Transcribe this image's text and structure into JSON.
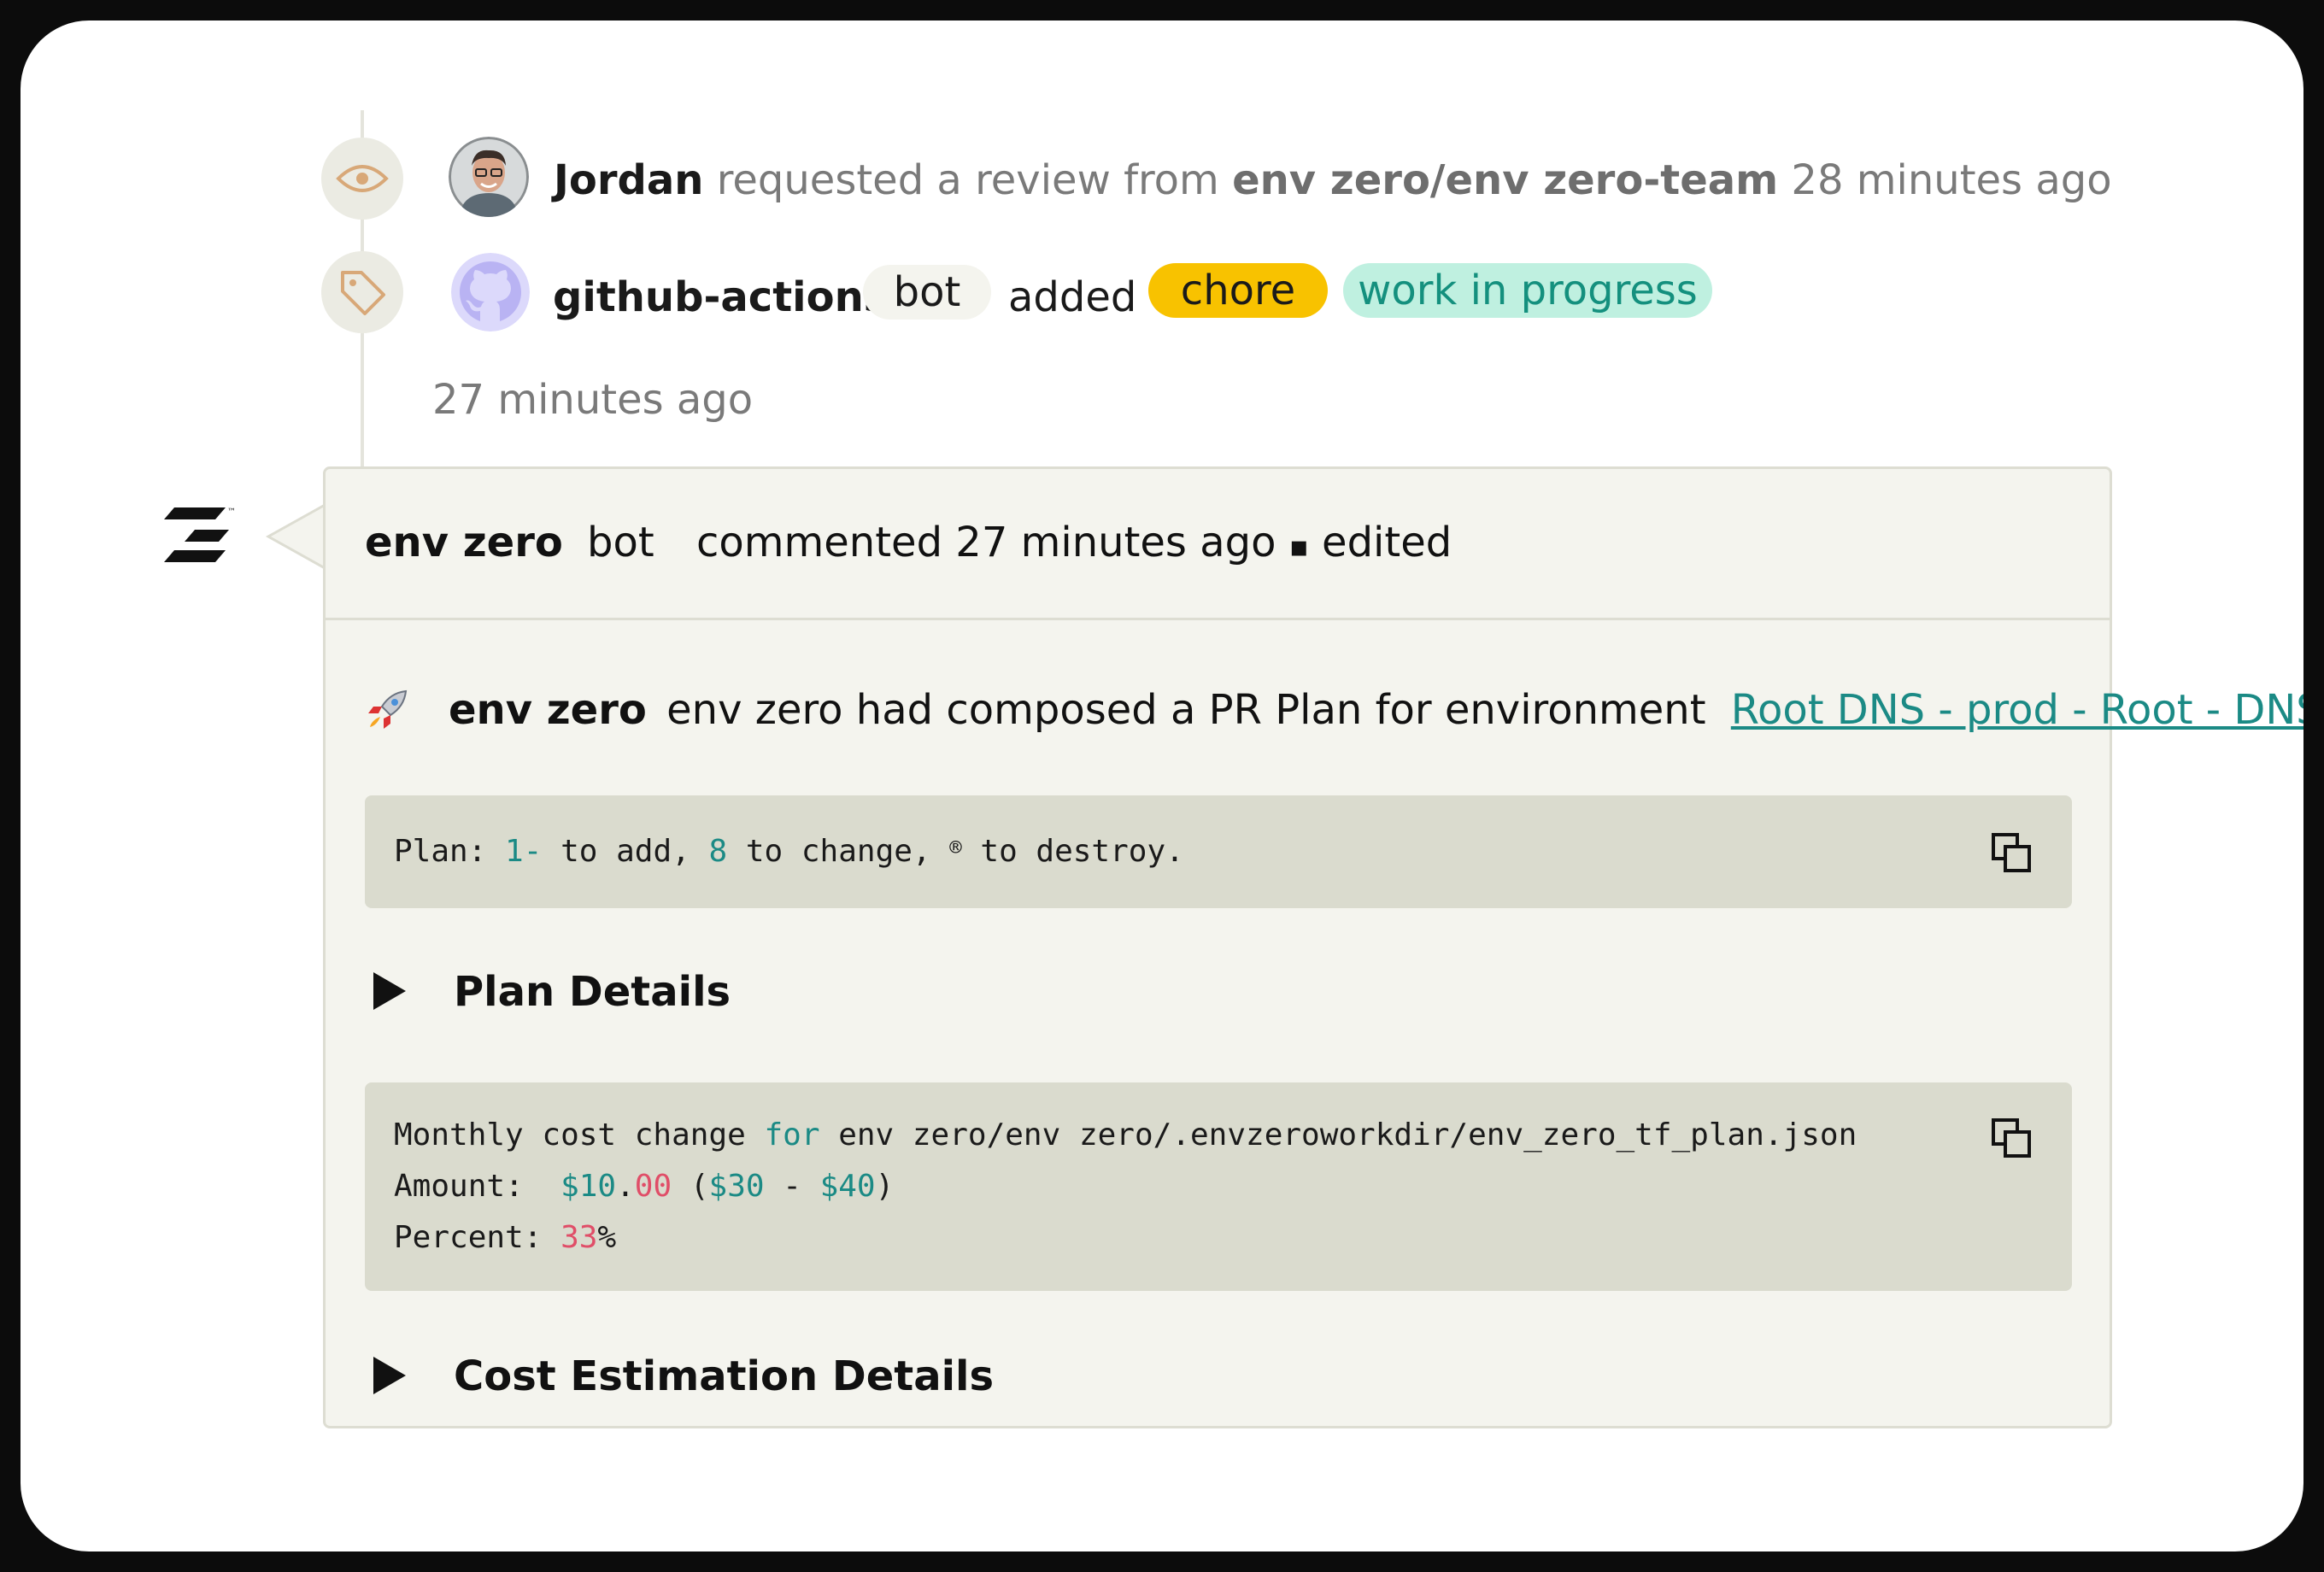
{
  "timeline": {
    "review_event": {
      "actor": "Jordan",
      "action": "requested a review from",
      "team": "env zero/env zero-team",
      "time": "28 minutes ago"
    },
    "label_event": {
      "actor": "github-actions",
      "actor_tag": "bot",
      "action": "added",
      "labels": [
        {
          "text": "chore",
          "color": "#f8c200",
          "text_color": "#1a1a1a"
        },
        {
          "text": "work in progress",
          "color": "#bff0e0",
          "text_color": "#14907e"
        }
      ],
      "time": "27 minutes ago"
    }
  },
  "comment": {
    "author": "env zero",
    "author_tag": "bot",
    "meta": "commented 27 minutes ago",
    "separator": "▪",
    "edited": "edited",
    "intro": {
      "app_name": "env zero",
      "message": "env zero had composed a PR Plan for environment",
      "link_text": "Root DNS - prod - Root - DNS:"
    },
    "plan_summary": {
      "prefix": "Plan: ",
      "add_count": "1-",
      "add_label": " to add, ",
      "change_count": "8",
      "change_label": " to change, ",
      "destroy_count": "®",
      "destroy_label": " to destroy."
    },
    "plan_details_label": "Plan Details",
    "cost": {
      "line1_prefix": "Monthly cost change ",
      "line1_keyword": "for",
      "line1_rest": " env zero/env zero/.envzeroworkdir/env_zero_tf_plan.json",
      "amount_label": "Amount:  ",
      "amount_int": "$10",
      "amount_dot": ".",
      "amount_cents": "00",
      "amount_open": " (",
      "amount_from": "$30",
      "amount_dash": " - ",
      "amount_to": "$40",
      "amount_close": ")",
      "percent_label": "Percent: ",
      "percent_value": "33",
      "percent_sign": "%"
    },
    "cost_details_label": "Cost Estimation Details"
  },
  "icons": {
    "review": "eye-icon",
    "label": "tag-icon",
    "copy": "copy-icon",
    "rocket": "rocket-icon",
    "logo": "env-zero-logo"
  },
  "colors": {
    "accent_teal": "#1b8a85",
    "accent_pink": "#e04e68",
    "icon_tan": "#d8a878"
  }
}
